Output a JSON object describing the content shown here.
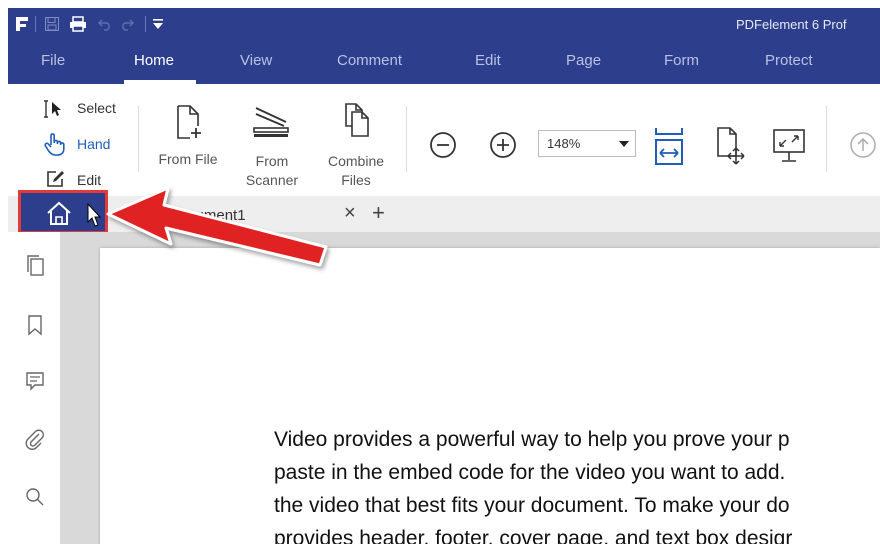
{
  "app": {
    "title": "PDFelement 6 Prof"
  },
  "menu": {
    "items": [
      "File",
      "Home",
      "View",
      "Comment",
      "Edit",
      "Page",
      "Form",
      "Protect"
    ],
    "active": "Home"
  },
  "ribbon": {
    "select_label": "Select",
    "hand_label": "Hand",
    "edit_label": "Edit",
    "from_file_label": "From File",
    "from_scanner_line1": "From",
    "from_scanner_line2": "Scanner",
    "combine_line1": "Combine",
    "combine_line2": "Files",
    "zoom_value": "148%"
  },
  "tabs": {
    "document_tab_label": "SampleDocument1",
    "close_glyph": "×",
    "add_glyph": "+"
  },
  "document": {
    "lines": [
      "Video provides a powerful way to help you prove your p",
      "paste in the embed code for the video you want to add.",
      "the video that best fits your document. To make your do",
      "provides header, footer, cover page, and text box desigr"
    ]
  },
  "colors": {
    "brand": "#2d3f8c",
    "icon_blue": "#1f5fb8",
    "highlight": "#e53935"
  }
}
